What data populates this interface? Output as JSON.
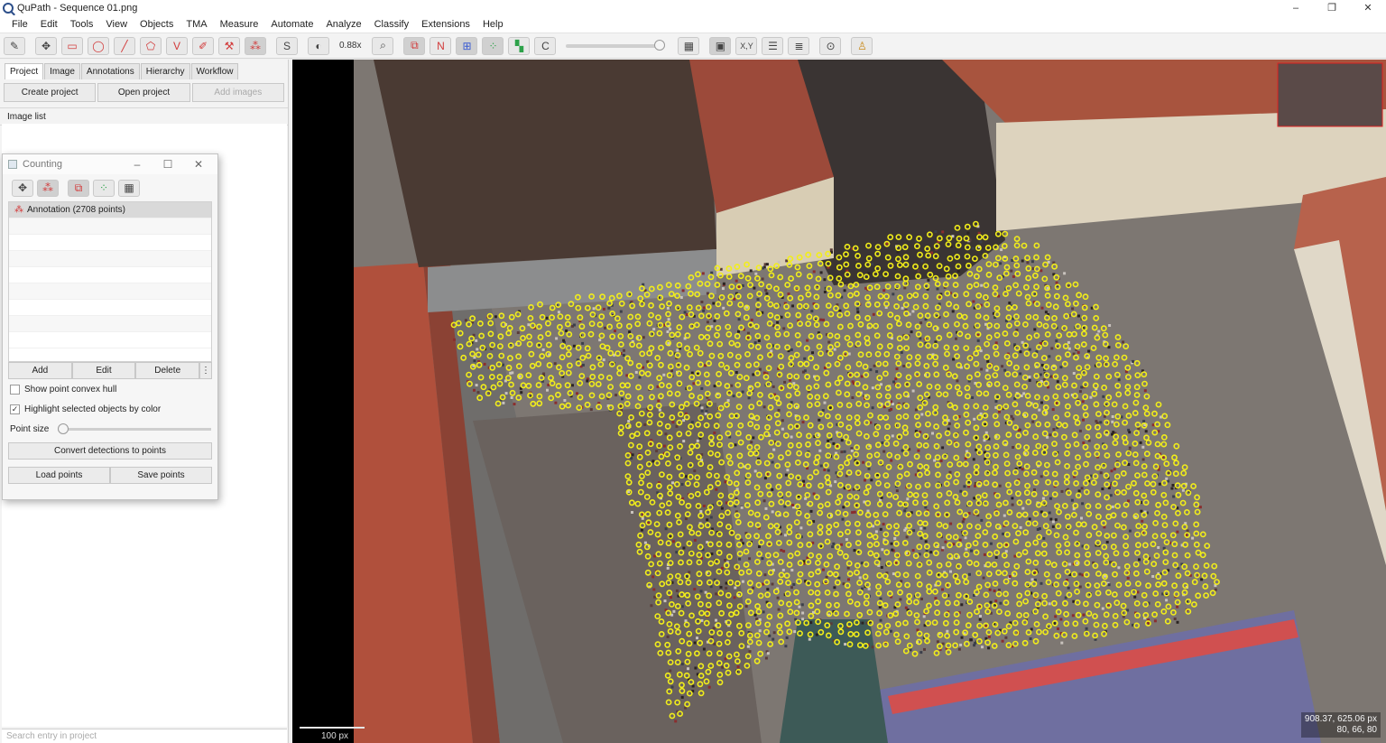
{
  "window": {
    "title": "QuPath - Sequence 01.png",
    "controls": [
      "–",
      "❐",
      "✕"
    ]
  },
  "menu": [
    "File",
    "Edit",
    "Tools",
    "View",
    "Objects",
    "TMA",
    "Measure",
    "Automate",
    "Analyze",
    "Classify",
    "Extensions",
    "Help"
  ],
  "toolbar": {
    "zoom": "0.88x",
    "opacity_value": 1.0,
    "icons": [
      "pen-tool-icon",
      "move-icon",
      "rectangle-icon",
      "ellipse-icon",
      "line-icon",
      "polygon-icon",
      "polyline-icon",
      "brush-icon",
      "wand-icon",
      "points-icon",
      "selection-mode-icon",
      "contrast-icon",
      "zoom-to-fit-icon",
      "show-annotations-icon",
      "show-names-icon",
      "show-tma-grid-icon",
      "show-detections-icon",
      "fill-detections-icon",
      "show-connections-icon",
      "overlay-opacity-icon",
      "grid-icon",
      "overview-icon",
      "location-icon",
      "scalebar-icon",
      "measurement-table-icon",
      "command-list-icon",
      "log-icon"
    ],
    "labels": {
      "s": "S",
      "n": "N",
      "c": "C",
      "xy": "X,Y"
    }
  },
  "leftpanel": {
    "tabs": [
      "Project",
      "Image",
      "Annotations",
      "Hierarchy",
      "Workflow"
    ],
    "active_tab": "Project",
    "buttons": {
      "create": "Create project",
      "open": "Open project",
      "add_images": "Add images"
    },
    "image_list_header": "Image list",
    "search_placeholder": "Search entry in project"
  },
  "counting": {
    "title": "Counting",
    "controls": [
      "–",
      "☐",
      "✕"
    ],
    "annotations": [
      {
        "label": "Annotation (2708 points)",
        "selected": true
      }
    ],
    "buttons": {
      "add": "Add",
      "edit": "Edit",
      "delete": "Delete",
      "more": "⋮"
    },
    "show_hull": {
      "label": "Show point convex hull",
      "checked": false
    },
    "highlight": {
      "label": "Highlight selected objects by color",
      "checked": true
    },
    "point_size_label": "Point size",
    "point_size_value": 0.0,
    "convert": "Convert detections to points",
    "load": "Load points",
    "save": "Save points"
  },
  "viewer": {
    "scale_label": "100 px",
    "cursor_position": "908.37, 625.06 px",
    "cursor_rgb": "80, 66, 80",
    "point_color": "#f2ee1a"
  }
}
